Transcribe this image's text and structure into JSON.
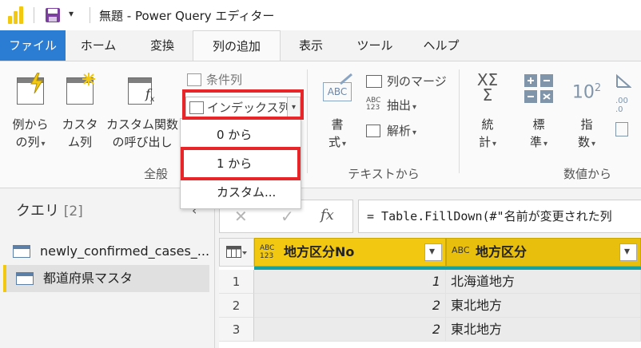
{
  "app": {
    "quick_access_caret": "▾",
    "title": "無題 - Power Query エディター",
    "brand_color": "#f2c811",
    "file_tab_color": "#2b7cd3"
  },
  "tabs": [
    {
      "label": "ファイル"
    },
    {
      "label": "ホーム"
    },
    {
      "label": "変換"
    },
    {
      "label": "列の追加"
    },
    {
      "label": "表示"
    },
    {
      "label": "ツール"
    },
    {
      "label": "ヘルプ"
    }
  ],
  "ribbon": {
    "general": {
      "example_col": [
        "例から",
        "の列"
      ],
      "custom_col": [
        "カスタ",
        "ム列"
      ],
      "invoke_fn": [
        "カスタム関数",
        "の呼び出し"
      ],
      "conditional_col": "条件列",
      "index_col": "インデックス列",
      "group_label": "全般"
    },
    "text": {
      "format": [
        "書",
        "式"
      ],
      "merge_cols": "列のマージ",
      "extract": "抽出",
      "parse": "解析",
      "group_label": "テキストから",
      "icon_text_abc": "ABC",
      "icon_text_123": "123"
    },
    "number": {
      "statistics": [
        "統",
        "計"
      ],
      "standard": [
        "標",
        "準"
      ],
      "scientific": [
        "指",
        "数"
      ],
      "group_label": "数値から",
      "icon_stat_top": "XΣ",
      "icon_stat_bottom": "Σ",
      "icon_sci_base": "10",
      "icon_sci_exp": "2",
      "icon_round": ".00",
      "icon_round_b": ".0"
    }
  },
  "dropdown": {
    "items": [
      {
        "label": "0 から"
      },
      {
        "label": "1 から"
      },
      {
        "label": "カスタム..."
      }
    ]
  },
  "queries": {
    "header": "クエリ",
    "count": "[2]",
    "collapse_icon": "‹",
    "items": [
      {
        "label": "newly_confirmed_cases_..."
      },
      {
        "label": "都道府県マスタ"
      }
    ]
  },
  "formula_bar": {
    "cancel": "✕",
    "commit": "✓",
    "fx": "fx",
    "text": "= Table.FillDown(#\"名前が変更された列"
  },
  "grid": {
    "columns": [
      {
        "type_top": "ABC",
        "type_bottom": "123",
        "label": "地方区分No"
      },
      {
        "type_top": "ABC",
        "type_bottom": "",
        "label": "地方区分"
      }
    ],
    "rows": [
      {
        "num": "1",
        "no": "1",
        "region": "北海道地方"
      },
      {
        "num": "2",
        "no": "2",
        "region": "東北地方"
      },
      {
        "num": "3",
        "no": "2",
        "region": "東北地方"
      }
    ]
  }
}
